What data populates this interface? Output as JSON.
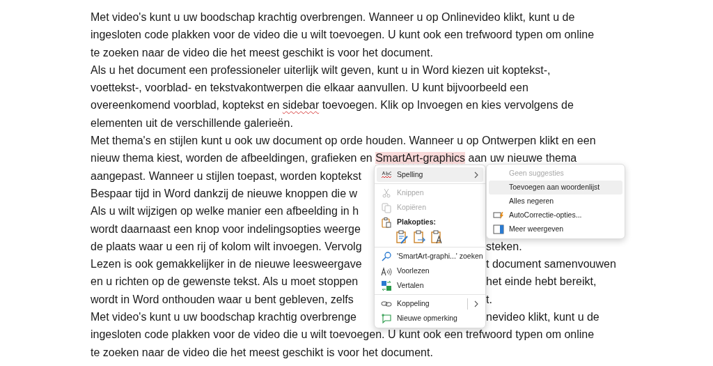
{
  "document": {
    "lines": [
      {
        "runs": [
          {
            "text": "Met video's kunt u uw boodschap krachtig overbrengen. Wanneer u op Onlinevideo klikt, kunt u de",
            "kind": "plain"
          }
        ]
      },
      {
        "runs": [
          {
            "text": "ingesloten code plakken voor de video die u wilt toevoegen. U kunt ook een trefwoord typen om online",
            "kind": "plain"
          }
        ]
      },
      {
        "runs": [
          {
            "text": "te zoeken naar de video die het meest geschikt is voor het document.",
            "kind": "plain"
          }
        ]
      },
      {
        "runs": [
          {
            "text": "Als u het document een professioneler uiterlijk wilt geven, kunt u in Word kiezen uit koptekst-,",
            "kind": "plain"
          }
        ]
      },
      {
        "runs": [
          {
            "text": "voettekst-, voorblad- en tekstvakontwerpen die elkaar aanvullen. U kunt bijvoorbeeld een",
            "kind": "plain"
          }
        ]
      },
      {
        "runs": [
          {
            "text": "overeenkomend voorblad, koptekst en ",
            "kind": "plain"
          },
          {
            "text": "sidebar",
            "kind": "misspelled",
            "selected": false
          },
          {
            "text": " toevoegen. Klik op Invoegen en kies vervolgens de",
            "kind": "plain"
          }
        ]
      },
      {
        "runs": [
          {
            "text": "elementen uit de verschillende galerieën.",
            "kind": "plain"
          }
        ]
      },
      {
        "runs": [
          {
            "text": "Met thema's en stijlen kunt u ook uw document op orde houden. Wanneer u op Ontwerpen klikt en een",
            "kind": "plain"
          }
        ]
      },
      {
        "runs": [
          {
            "text": "nieuw thema kiest, worden de afbeeldingen, grafieken en ",
            "kind": "plain"
          },
          {
            "text": "SmartArt-graphics",
            "kind": "misspelled",
            "selected": true
          },
          {
            "text": " aan uw nieuwe thema",
            "kind": "plain"
          }
        ]
      },
      {
        "runs": [
          {
            "text": "aangepast. Wanneer u stijlen toepast, worden koptekst",
            "kind": "plain"
          }
        ]
      },
      {
        "runs": [
          {
            "text": "Bespaar tijd in Word dankzij de nieuwe knoppen die w",
            "kind": "plain"
          }
        ]
      },
      {
        "runs": [
          {
            "text": "Als u wilt wijzigen op welke manier een afbeelding in h",
            "kind": "plain"
          }
        ]
      },
      {
        "runs": [
          {
            "text": "wordt daarnaast een knop voor indelingsopties weerge",
            "kind": "plain"
          }
        ]
      },
      {
        "runs": [
          {
            "text": "de plaats waar u een rij of kolom wilt invoegen. Vervolg",
            "kind": "plain"
          }
        ],
        "right": "steken."
      },
      {
        "runs": [
          {
            "text": "Lezen is ook gemakkelijker in de nieuwe leesweergave",
            "kind": "plain"
          }
        ],
        "right": "t document samenvouwen"
      },
      {
        "runs": [
          {
            "text": "en u richten op de gewenste tekst. Als u moet stoppen",
            "kind": "plain"
          }
        ],
        "right": "het einde hebt bereikt,"
      },
      {
        "runs": [
          {
            "text": "wordt in Word onthouden waar u bent gebleven, zelfs",
            "kind": "plain"
          }
        ],
        "right": "t."
      },
      {
        "runs": [
          {
            "text": "Met video's kunt u uw boodschap krachtig overbrenge",
            "kind": "plain"
          }
        ],
        "right": "nevideo klikt, kunt u de"
      },
      {
        "runs": [
          {
            "text": "ingesloten code plakken voor de video die u wilt toevoegen. U kunt ook een trefwoord typen om online",
            "kind": "plain"
          }
        ]
      },
      {
        "runs": [
          {
            "text": "te zoeken naar de video die het meest geschikt is voor het document.",
            "kind": "plain"
          }
        ]
      }
    ]
  },
  "context_menu": {
    "items": [
      {
        "kind": "submenu",
        "label": "Spelling",
        "disabled": false,
        "highlighted": true
      },
      {
        "kind": "divider"
      },
      {
        "kind": "action",
        "label": "Knippen",
        "disabled": true,
        "highlighted": false
      },
      {
        "kind": "action",
        "label": "Kopiëren",
        "disabled": true,
        "highlighted": false
      },
      {
        "kind": "paste_header",
        "label": "Plakopties:",
        "disabled": false,
        "highlighted": false
      },
      {
        "kind": "divider"
      },
      {
        "kind": "action",
        "label": "'SmartArt-graphi...' zoeken",
        "disabled": false,
        "highlighted": false
      },
      {
        "kind": "action",
        "label": "Voorlezen",
        "disabled": false,
        "highlighted": false
      },
      {
        "kind": "action",
        "label": "Vertalen",
        "disabled": false,
        "highlighted": false
      },
      {
        "kind": "divider"
      },
      {
        "kind": "submenu",
        "label": "Koppeling",
        "disabled": false,
        "highlighted": false
      },
      {
        "kind": "action",
        "label": "Nieuwe opmerking",
        "disabled": false,
        "highlighted": false
      }
    ]
  },
  "spelling_submenu": {
    "items": [
      {
        "label": "Geen suggesties",
        "disabled": true,
        "highlighted": false
      },
      {
        "label": "Toevoegen aan woordenlijst",
        "disabled": false,
        "highlighted": true
      },
      {
        "label": "Alles negeren",
        "disabled": false,
        "highlighted": false
      },
      {
        "label": "AutoCorrectie-opties...",
        "disabled": false,
        "highlighted": false
      },
      {
        "label": "Meer weergeven",
        "disabled": false,
        "highlighted": false
      }
    ]
  }
}
